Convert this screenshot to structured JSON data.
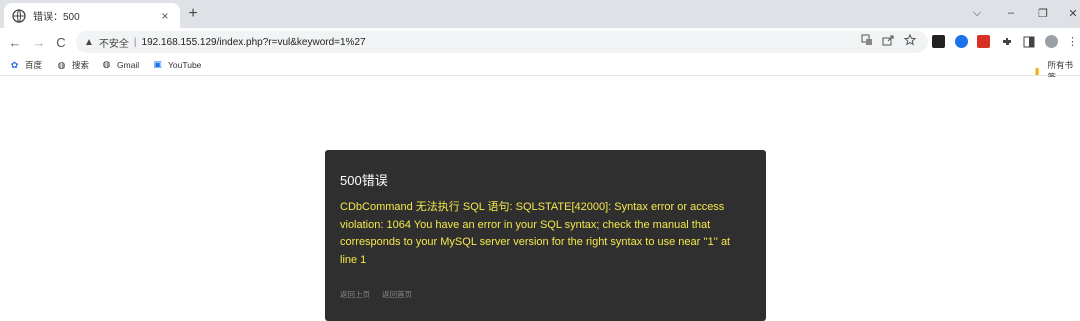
{
  "browser": {
    "tab": {
      "title": "错误：500",
      "favicon": "globe-icon",
      "close": "×"
    },
    "new_tab": "+",
    "window_controls": {
      "dropdown": "⌵",
      "minimize": "–",
      "restore": "❐",
      "close": "✕"
    },
    "nav": {
      "back": "←",
      "forward": "→",
      "reload": "C"
    },
    "address": {
      "warning": "▲",
      "security_label": "不安全",
      "separator": "|",
      "url": "192.168.155.129/index.php?r=vul&keyword=1%27"
    },
    "bookmarks": [
      {
        "icon": "translate-icon",
        "label": "百度"
      },
      {
        "icon": "globe-icon",
        "label": "搜索"
      },
      {
        "icon": "globe-icon",
        "label": "Gmail"
      },
      {
        "icon": "youtube-icon",
        "label": "YouTube"
      }
    ],
    "all_bookmarks": "所有书签"
  },
  "error": {
    "title": "500错误",
    "message": "CDbCommand 无法执行 SQL 语句: SQLSTATE[42000]: Syntax error or access violation: 1064 You have an error in your SQL syntax; check the manual that corresponds to your MySQL server version for the right syntax to use near ''1'' at line 1",
    "links": [
      "返回上页",
      "返回首页"
    ]
  },
  "colors": {
    "error_bg": "#2f2f2f",
    "error_text": "#f5e74b",
    "title_text": "#ffffff",
    "link_text": "#8a8a8a"
  }
}
